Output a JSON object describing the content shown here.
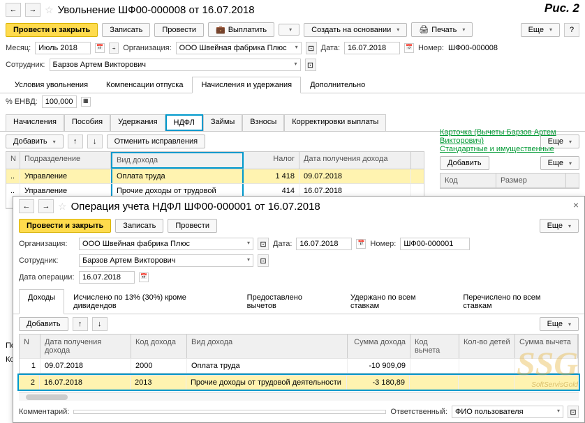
{
  "fig_label": "Рис. 2",
  "win1": {
    "title": "Увольнение ШФ00-000008 от 16.07.2018",
    "buttons": {
      "post_close": "Провести и закрыть",
      "save": "Записать",
      "post": "Провести",
      "pay": "Выплатить",
      "create_based": "Создать на основании",
      "print": "Печать",
      "more": "Еще"
    },
    "fields": {
      "month_label": "Месяц:",
      "month_value": "Июль 2018",
      "org_label": "Организация:",
      "org_value": "ООО Швейная фабрика Плюс",
      "date_label": "Дата:",
      "date_value": "16.07.2018",
      "number_label": "Номер:",
      "number_value": "ШФ00-000008",
      "employee_label": "Сотрудник:",
      "employee_value": "Барзов Артем Викторович"
    },
    "tabs": [
      "Условия увольнения",
      "Компенсации отпуска",
      "Начисления и удержания",
      "Дополнительно"
    ],
    "active_tab": 2,
    "envd_label": "% ЕНВД:",
    "envd_value": "100,000",
    "subtabs": [
      "Начисления",
      "Пособия",
      "Удержания",
      "НДФЛ",
      "Займы",
      "Взносы",
      "Корректировки выплаты"
    ],
    "active_subtab": 3,
    "sub_toolbar": {
      "add": "Добавить",
      "cancel_fix": "Отменить исправления",
      "more": "Еще"
    },
    "ndfl_table": {
      "headers": [
        "N",
        "Подразделение",
        "Вид дохода",
        "Налог",
        "Дата получения дохода"
      ],
      "rows": [
        {
          "n": "..",
          "dept": "Управление",
          "type": "Оплата труда",
          "tax": "1 418",
          "date": "09.07.2018"
        },
        {
          "n": "..",
          "dept": "Управление",
          "type": "Прочие доходы от трудовой деятел...",
          "tax": "414",
          "date": "16.07.2018"
        }
      ]
    },
    "right": {
      "card": "Карточка (Вычеты Барзов Артем Викторович)",
      "std": "Стандартные и имущественные",
      "add": "Добавить",
      "more": "Еще",
      "headers": [
        "Код",
        "Размер"
      ]
    }
  },
  "left_cut": {
    "p": "По",
    "k": "Ком"
  },
  "win2": {
    "title": "Операция учета НДФЛ ШФ00-000001 от 16.07.2018",
    "buttons": {
      "post_close": "Провести и закрыть",
      "save": "Записать",
      "post": "Провести",
      "more": "Еще"
    },
    "fields": {
      "org_label": "Организация:",
      "org_value": "ООО Швейная фабрика Плюс",
      "date_label": "Дата:",
      "date_value": "16.07.2018",
      "number_label": "Номер:",
      "number_value": "ШФ00-000001",
      "employee_label": "Сотрудник:",
      "employee_value": "Барзов Артем Викторович",
      "op_date_label": "Дата операции:",
      "op_date_value": "16.07.2018"
    },
    "tabs": [
      "Доходы",
      "Исчислено по 13% (30%) кроме дивидендов",
      "Предоставлено вычетов",
      "Удержано по всем ставкам",
      "Перечислено по всем ставкам"
    ],
    "active_tab": 0,
    "sub_toolbar": {
      "add": "Добавить",
      "more": "Еще"
    },
    "table": {
      "headers": [
        "N",
        "Дата получения дохода",
        "Код дохода",
        "Вид дохода",
        "Сумма дохода",
        "Код вычета",
        "Кол-во детей",
        "Сумма вычета"
      ],
      "rows": [
        {
          "n": "1",
          "date": "09.07.2018",
          "code": "2000",
          "type": "Оплата труда",
          "amount": "-10 909,09",
          "dcode": "",
          "kids": "",
          "dsum": ""
        },
        {
          "n": "2",
          "date": "16.07.2018",
          "code": "2013",
          "type": "Прочие доходы от трудовой деятельности",
          "amount": "-3 180,89",
          "dcode": "",
          "kids": "",
          "dsum": ""
        }
      ]
    },
    "footer": {
      "comment_label": "Комментарий:",
      "resp_label": "Ответственный:",
      "resp_value": "ФИО пользователя"
    }
  },
  "watermark": "SSG",
  "watermark_sub": "SoftServisGold"
}
